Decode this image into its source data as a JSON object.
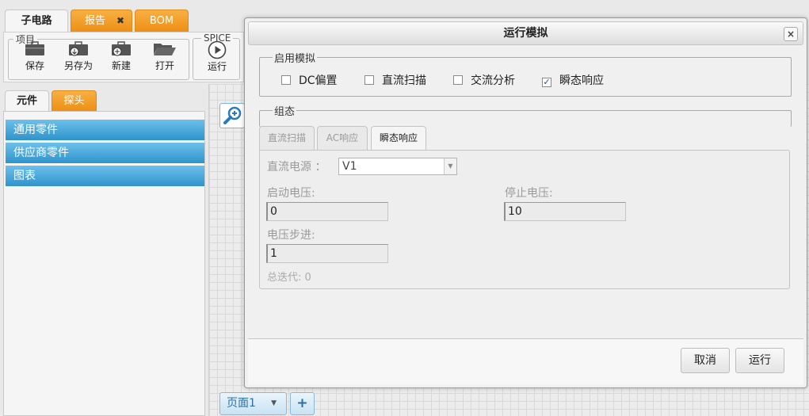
{
  "top_tabs": [
    {
      "label": "子电路"
    },
    {
      "label": "报告"
    },
    {
      "label": "BOM"
    }
  ],
  "toolbar": {
    "project_group_label": "项目",
    "spice_group_label": "SPICE",
    "save_label": "保存",
    "save_as_label": "另存为",
    "new_label": "新建",
    "open_label": "打开",
    "run_label": "运行"
  },
  "side_tabs": [
    {
      "label": "元件"
    },
    {
      "label": "探头"
    }
  ],
  "sidebar": {
    "items": [
      {
        "label": "通用零件"
      },
      {
        "label": "供应商零件"
      },
      {
        "label": "图表"
      }
    ]
  },
  "page_bar": {
    "page_label": "页面1",
    "add_label": "+"
  },
  "dialog": {
    "title": "运行模拟",
    "close_label": "×",
    "enable_section_label": "启用模拟",
    "options": [
      {
        "label": "DC偏置",
        "checked": false
      },
      {
        "label": "直流扫描",
        "checked": false
      },
      {
        "label": "交流分析",
        "checked": false
      },
      {
        "label": "瞬态响应",
        "checked": true
      }
    ],
    "config_section_label": "组态",
    "config_tabs": [
      {
        "label": "直流扫描"
      },
      {
        "label": "AC响应"
      },
      {
        "label": "瞬态响应"
      }
    ],
    "fields": {
      "dc_source_label": "直流电源 ：",
      "dc_source_value": "V1",
      "start_voltage_label": "启动电压:",
      "start_voltage_value": "0",
      "stop_voltage_label": "停止电压:",
      "stop_voltage_value": "10",
      "step_label": "电压步进:",
      "step_value": "1",
      "total_iterations": "总迭代: 0"
    },
    "cancel_label": "取消",
    "run_label": "运行"
  },
  "colors": {
    "orange_tab": "#ee8f14",
    "accordion_blue": "#2f93cc",
    "check_mark": "#2a4d8a"
  }
}
